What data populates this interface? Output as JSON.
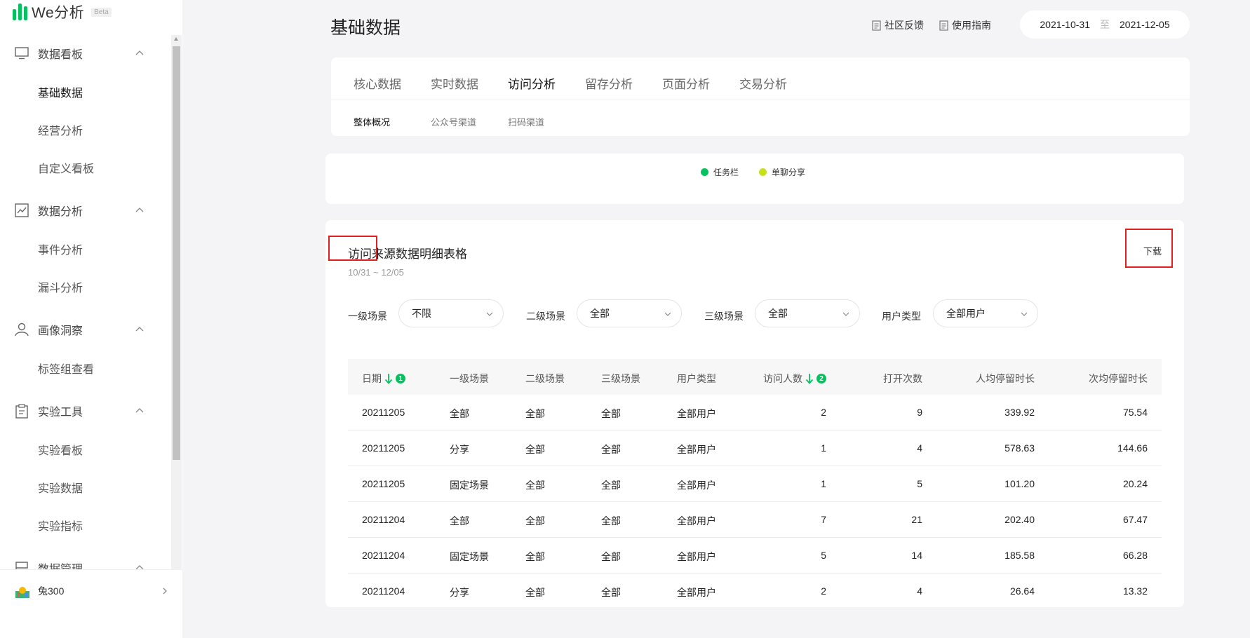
{
  "app": {
    "name": "We分析",
    "badge": "Beta"
  },
  "sidebar": {
    "groups": [
      {
        "label": "数据看板",
        "icon": "monitor-icon",
        "items": [
          "基础数据",
          "经营分析",
          "自定义看板"
        ]
      },
      {
        "label": "数据分析",
        "icon": "line-chart-icon",
        "items": [
          "事件分析",
          "漏斗分析"
        ]
      },
      {
        "label": "画像洞察",
        "icon": "user-icon",
        "items": [
          "标签组查看"
        ]
      },
      {
        "label": "实验工具",
        "icon": "clipboard-icon",
        "items": [
          "实验看板",
          "实验数据",
          "实验指标"
        ]
      },
      {
        "label": "数据管理",
        "icon": "flag-icon",
        "items": []
      }
    ],
    "active_item": "基础数据",
    "footer": {
      "name": "兔300",
      "avatar": "mini-program-avatar"
    }
  },
  "header": {
    "title": "基础数据",
    "links": [
      {
        "label": "社区反馈",
        "icon": "doc-icon"
      },
      {
        "label": "使用指南",
        "icon": "doc-icon"
      }
    ],
    "date_start": "2021-10-31",
    "date_sep": "至",
    "date_end": "2021-12-05"
  },
  "tabs": [
    "核心数据",
    "实时数据",
    "访问分析",
    "留存分析",
    "页面分析",
    "交易分析"
  ],
  "active_tab": "访问分析",
  "subtabs": [
    "整体概况",
    "公众号渠道",
    "扫码渠道"
  ],
  "active_subtab": "整体概况",
  "chart_legend": [
    {
      "name": "任务栏",
      "color": "#07c160"
    },
    {
      "name": "单聊分享",
      "color": "#c8e01c"
    }
  ],
  "table_card": {
    "title": "访问来源数据明细表格",
    "range": "10/31 ~ 12/05",
    "download": "下载",
    "filters": [
      {
        "label": "一级场景",
        "value": "不限"
      },
      {
        "label": "二级场景",
        "value": "全部"
      },
      {
        "label": "三级场景",
        "value": "全部"
      },
      {
        "label": "用户类型",
        "value": "全部用户"
      }
    ],
    "columns": [
      "日期",
      "一级场景",
      "二级场景",
      "三级场景",
      "用户类型",
      "访问人数",
      "打开次数",
      "人均停留时长",
      "次均停留时长"
    ],
    "sort_badges": {
      "date": "1",
      "visitors": "2"
    },
    "rows": [
      [
        "20211205",
        "全部",
        "全部",
        "全部",
        "全部用户",
        "2",
        "9",
        "339.92",
        "75.54"
      ],
      [
        "20211205",
        "分享",
        "全部",
        "全部",
        "全部用户",
        "1",
        "4",
        "578.63",
        "144.66"
      ],
      [
        "20211205",
        "固定场景",
        "全部",
        "全部",
        "全部用户",
        "1",
        "5",
        "101.20",
        "20.24"
      ],
      [
        "20211204",
        "全部",
        "全部",
        "全部",
        "全部用户",
        "7",
        "21",
        "202.40",
        "67.47"
      ],
      [
        "20211204",
        "固定场景",
        "全部",
        "全部",
        "全部用户",
        "5",
        "14",
        "185.58",
        "66.28"
      ],
      [
        "20211204",
        "分享",
        "全部",
        "全部",
        "全部用户",
        "2",
        "4",
        "26.64",
        "13.32"
      ]
    ]
  },
  "colors": {
    "accent": "#07c160",
    "highlight": "#e02020"
  }
}
